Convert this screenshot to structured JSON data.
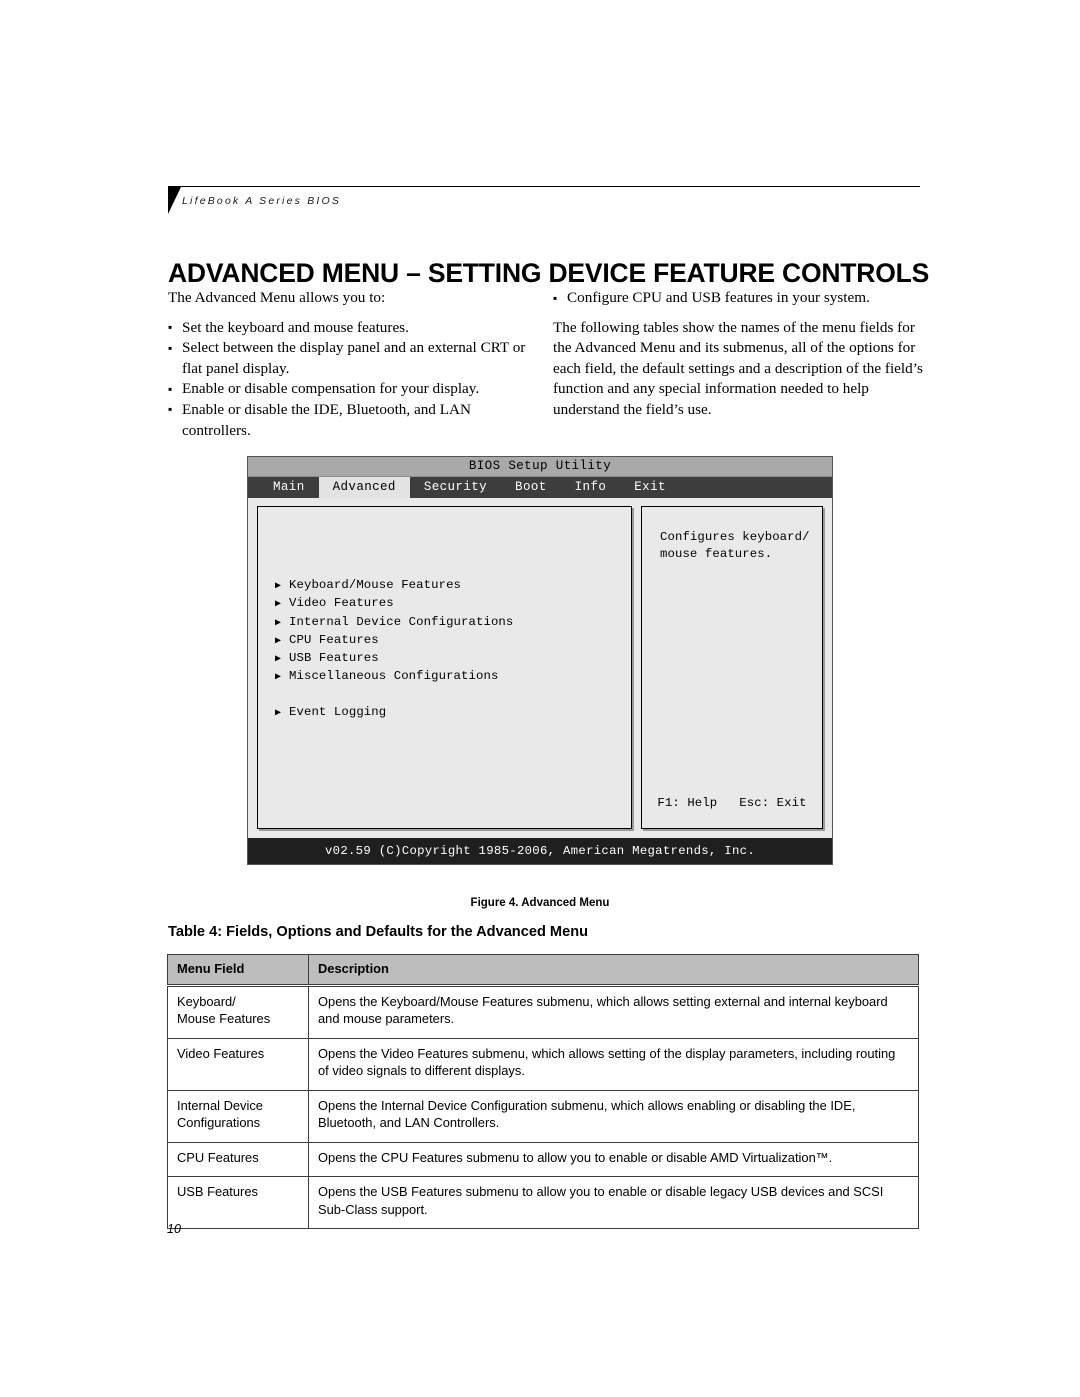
{
  "running_header": {
    "text": "LifeBook A Series BIOS"
  },
  "page_title": "ADVANCED MENU – SETTING DEVICE FEATURE CONTROLS",
  "left_column": {
    "intro": "The Advanced Menu allows you to:",
    "bullets": [
      "Set the keyboard and mouse features.",
      "Select between the display panel and an external CRT or flat panel display.",
      "Enable or disable compensation for your display.",
      "Enable or disable the IDE, Bluetooth, and LAN controllers."
    ]
  },
  "right_column": {
    "bullets": [
      "Configure CPU and USB features in your system."
    ],
    "paragraph": "The following tables show the names of the menu fields for the Advanced Menu and its submenus, all of the options for each field, the default settings and a description of the field’s function and any special information needed to help understand the field’s use."
  },
  "bios": {
    "title": "BIOS Setup Utility",
    "tabs": [
      {
        "label": "Main",
        "active": false
      },
      {
        "label": "Advanced",
        "active": true
      },
      {
        "label": "Security",
        "active": false
      },
      {
        "label": "Boot",
        "active": false
      },
      {
        "label": "Info",
        "active": false
      },
      {
        "label": "Exit",
        "active": false
      }
    ],
    "menu_items": [
      {
        "label": "Keyboard/Mouse Features",
        "gap_after": false
      },
      {
        "label": "Video Features",
        "gap_after": false
      },
      {
        "label": "Internal Device Configurations",
        "gap_after": false
      },
      {
        "label": "CPU Features",
        "gap_after": false
      },
      {
        "label": "USB Features",
        "gap_after": false
      },
      {
        "label": "Miscellaneous Configurations",
        "gap_after": true
      },
      {
        "label": "Event Logging",
        "gap_after": false
      }
    ],
    "help_line_1": "Configures keyboard/",
    "help_line_2": "mouse features.",
    "key_help": "F1: Help",
    "key_exit": "Esc: Exit",
    "footer": "v02.59 (C)Copyright 1985-2006, American Megatrends, Inc.",
    "colors": {
      "titlebar_bg": "#a9a9a9",
      "tabbar_bg": "#3d3d3d",
      "active_tab_bg": "#e3e3e3",
      "body_bg": "#e9e9e9",
      "footer_bg": "#1f1f1f"
    }
  },
  "figure_caption": "Figure 4.  Advanced Menu",
  "table": {
    "title": "Table 4: Fields, Options and Defaults for the Advanced Menu",
    "headers": [
      "Menu Field",
      "Description"
    ],
    "rows": [
      {
        "field": "Keyboard/\nMouse Features",
        "description": "Opens the Keyboard/Mouse Features submenu, which allows setting external and internal keyboard and mouse parameters."
      },
      {
        "field": "Video Features",
        "description": "Opens the Video Features submenu, which allows setting of the display parameters, including routing of video signals to different displays."
      },
      {
        "field": "Internal Device\nConfigurations",
        "description": "Opens the Internal Device Configuration submenu, which allows enabling or disabling the IDE, Bluetooth, and LAN Controllers."
      },
      {
        "field": "CPU Features",
        "description": "Opens the CPU Features submenu to allow you to enable or disable AMD Virtualization™."
      },
      {
        "field": "USB Features",
        "description": "Opens the USB Features submenu to allow you to enable or disable legacy USB devices and SCSI Sub-Class support."
      }
    ]
  },
  "page_number": "10"
}
